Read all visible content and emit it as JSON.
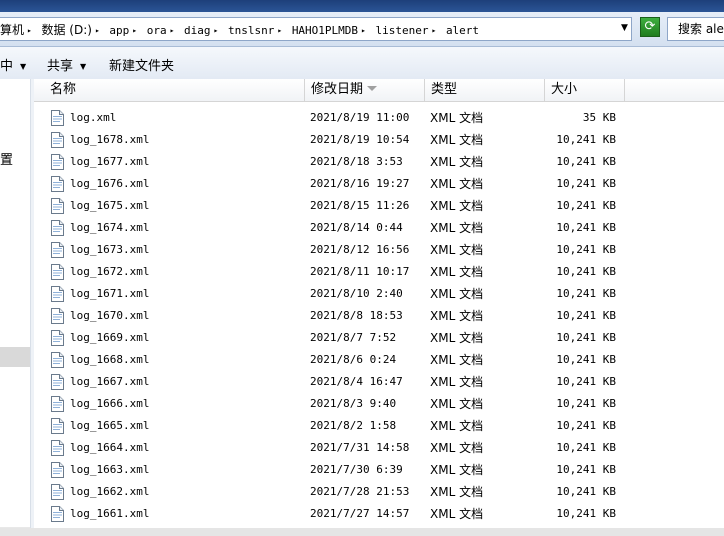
{
  "address": {
    "segments": [
      "算机",
      "数据 (D:)",
      "app",
      "ora",
      "diag",
      "tnslsnr",
      "HAHO1PLMDB",
      "listener",
      "alert"
    ],
    "dropdown_icon": "chevron-down-icon",
    "refresh_icon": "refresh-icon"
  },
  "search": {
    "label": "搜索 ale"
  },
  "toolbar": {
    "item1": "中",
    "share": "共享",
    "new_folder": "新建文件夹"
  },
  "nav": {
    "partial_label": "置"
  },
  "columns": {
    "name": "名称",
    "date": "修改日期",
    "type": "类型",
    "size": "大小"
  },
  "files": [
    {
      "name": "log.xml",
      "date": "2021/8/19 11:00",
      "type": "XML 文档",
      "size": "35 KB"
    },
    {
      "name": "log_1678.xml",
      "date": "2021/8/19 10:54",
      "type": "XML 文档",
      "size": "10,241 KB"
    },
    {
      "name": "log_1677.xml",
      "date": "2021/8/18 3:53",
      "type": "XML 文档",
      "size": "10,241 KB"
    },
    {
      "name": "log_1676.xml",
      "date": "2021/8/16 19:27",
      "type": "XML 文档",
      "size": "10,241 KB"
    },
    {
      "name": "log_1675.xml",
      "date": "2021/8/15 11:26",
      "type": "XML 文档",
      "size": "10,241 KB"
    },
    {
      "name": "log_1674.xml",
      "date": "2021/8/14 0:44",
      "type": "XML 文档",
      "size": "10,241 KB"
    },
    {
      "name": "log_1673.xml",
      "date": "2021/8/12 16:56",
      "type": "XML 文档",
      "size": "10,241 KB"
    },
    {
      "name": "log_1672.xml",
      "date": "2021/8/11 10:17",
      "type": "XML 文档",
      "size": "10,241 KB"
    },
    {
      "name": "log_1671.xml",
      "date": "2021/8/10 2:40",
      "type": "XML 文档",
      "size": "10,241 KB"
    },
    {
      "name": "log_1670.xml",
      "date": "2021/8/8 18:53",
      "type": "XML 文档",
      "size": "10,241 KB"
    },
    {
      "name": "log_1669.xml",
      "date": "2021/8/7 7:52",
      "type": "XML 文档",
      "size": "10,241 KB"
    },
    {
      "name": "log_1668.xml",
      "date": "2021/8/6 0:24",
      "type": "XML 文档",
      "size": "10,241 KB"
    },
    {
      "name": "log_1667.xml",
      "date": "2021/8/4 16:47",
      "type": "XML 文档",
      "size": "10,241 KB"
    },
    {
      "name": "log_1666.xml",
      "date": "2021/8/3 9:40",
      "type": "XML 文档",
      "size": "10,241 KB"
    },
    {
      "name": "log_1665.xml",
      "date": "2021/8/2 1:58",
      "type": "XML 文档",
      "size": "10,241 KB"
    },
    {
      "name": "log_1664.xml",
      "date": "2021/7/31 14:58",
      "type": "XML 文档",
      "size": "10,241 KB"
    },
    {
      "name": "log_1663.xml",
      "date": "2021/7/30 6:39",
      "type": "XML 文档",
      "size": "10,241 KB"
    },
    {
      "name": "log_1662.xml",
      "date": "2021/7/28 21:53",
      "type": "XML 文档",
      "size": "10,241 KB"
    },
    {
      "name": "log_1661.xml",
      "date": "2021/7/27 14:57",
      "type": "XML 文档",
      "size": "10,241 KB"
    }
  ],
  "file_icon": "xml-document-icon"
}
